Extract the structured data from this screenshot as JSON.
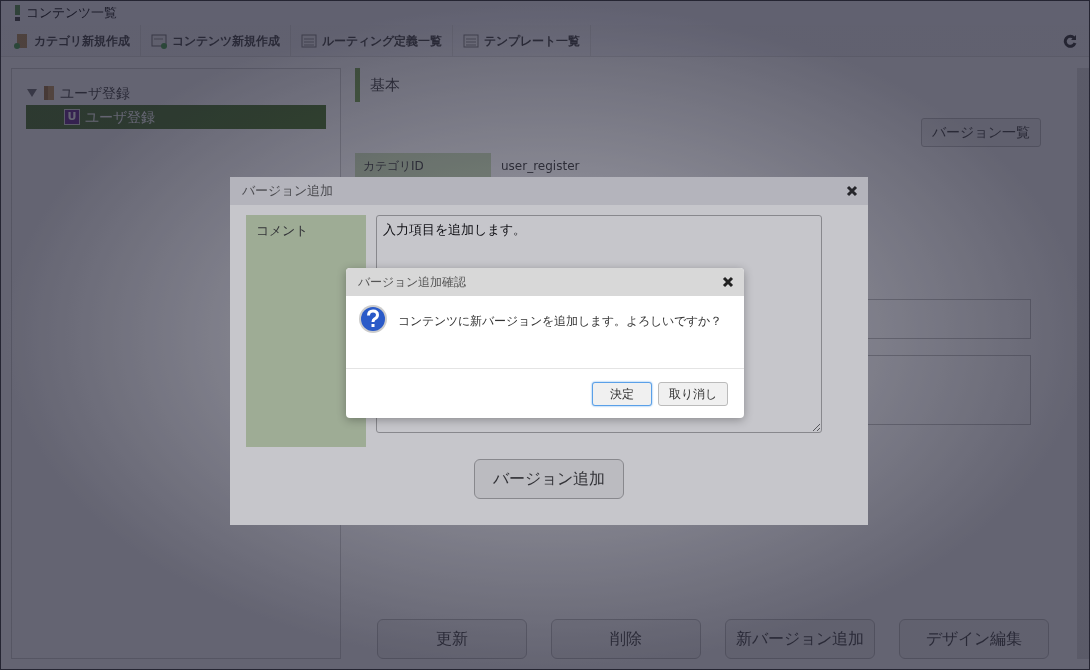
{
  "window": {
    "title": "コンテンツ一覧"
  },
  "toolbar": {
    "items": [
      {
        "label": "カテゴリ新規作成",
        "kind": "folder-add"
      },
      {
        "label": "コンテンツ新規作成",
        "kind": "form-add"
      },
      {
        "label": "ルーティング定義一覧",
        "kind": "list"
      },
      {
        "label": "テンプレート一覧",
        "kind": "list"
      }
    ]
  },
  "tree": {
    "items": [
      {
        "label": "ユーザ登録",
        "expanded": true,
        "selected": false,
        "children": [
          {
            "label": "ユーザ登録",
            "badge": "U",
            "selected": true
          }
        ]
      }
    ]
  },
  "content": {
    "section_title": "基本",
    "version_list_button": "バージョン一覧",
    "fields": [
      {
        "label": "カテゴリID",
        "value": "user_register"
      }
    ],
    "multi_rows": [
      {
        "kind": "input"
      },
      {
        "kind": "textarea"
      }
    ],
    "footer_buttons": [
      "更新",
      "削除",
      "新バージョン追加",
      "デザイン編集"
    ]
  },
  "dialog": {
    "title": "バージョン追加",
    "comment_label": "コメント",
    "comment_value": "入力項目を追加します。",
    "submit": "バージョン追加"
  },
  "confirm": {
    "title": "バージョン追加確認",
    "message": "コンテンツに新バージョンを追加します。よろしいですか？",
    "buttons": [
      {
        "label": "決定",
        "focused": true
      },
      {
        "label": "取り消し",
        "focused": false
      }
    ]
  }
}
